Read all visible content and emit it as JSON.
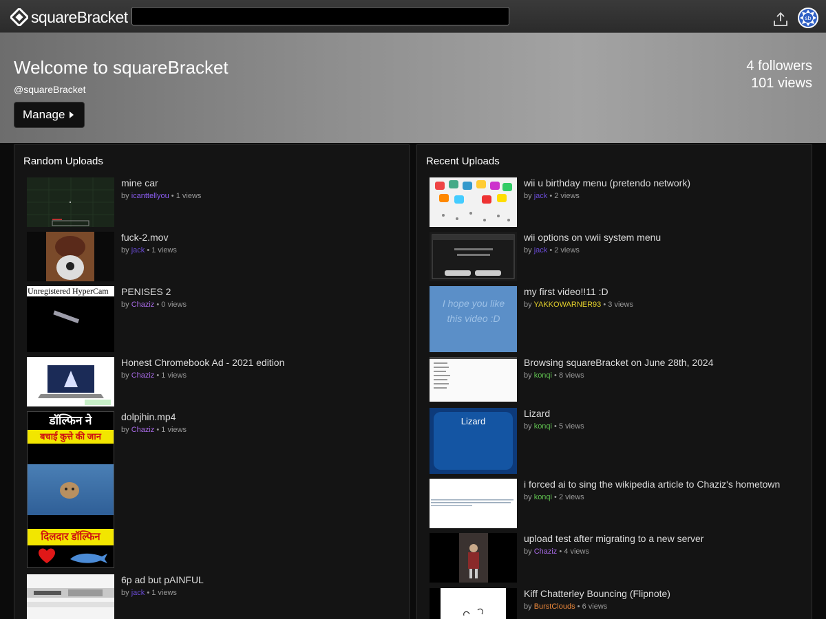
{
  "site": {
    "name": "squareBracket",
    "search_value": ""
  },
  "banner": {
    "title": "Welcome to squareBracket",
    "handle": "@squareBracket",
    "manage_label": "Manage",
    "followers": "4 followers",
    "views": "101 views"
  },
  "random": {
    "heading": "Random Uploads",
    "items": [
      {
        "title": "mine car",
        "by": "by",
        "author": "icanttellyou",
        "views": "• 1 views"
      },
      {
        "title": "fuck-2.mov",
        "by": "by",
        "author": "jack",
        "views": "• 1 views"
      },
      {
        "title": "PENISES 2",
        "by": "by",
        "author": "Chaziz",
        "views": "• 0 views",
        "thumb_text": "Unregistered HyperCam"
      },
      {
        "title": "Honest Chromebook Ad - 2021 edition",
        "by": "by",
        "author": "Chaziz",
        "views": "• 1 views"
      },
      {
        "title": "dolpjhin.mp4",
        "by": "by",
        "author": "Chaziz",
        "views": "• 1 views",
        "thumb_top_1": "डॉल्फिन ने",
        "thumb_top_2": "बचाई कुत्ते की जान",
        "thumb_bottom": "दिलदार डॉल्फिन"
      },
      {
        "title": "6p ad but pAINFUL",
        "by": "by",
        "author": "jack",
        "views": "• 1 views"
      }
    ]
  },
  "recent": {
    "heading": "Recent Uploads",
    "items": [
      {
        "title": "wii u birthday menu (pretendo network)",
        "by": "by",
        "author": "jack",
        "views": "• 2 views"
      },
      {
        "title": "wii options on vwii system menu",
        "by": "by",
        "author": "jack",
        "views": "• 2 views"
      },
      {
        "title": "my first video!!11 :D",
        "by": "by",
        "author": "YAKKOWARNER93",
        "views": "• 3 views",
        "thumb_text": "I hope you like this video :D"
      },
      {
        "title": "Browsing squareBracket on June 28th, 2024",
        "by": "by",
        "author": "konqi",
        "views": "• 8 views"
      },
      {
        "title": "Lizard",
        "by": "by",
        "author": "konqi",
        "views": "• 5 views",
        "thumb_text": "Lizard"
      },
      {
        "title": "i forced ai to sing the wikipedia article to Chaziz's hometown",
        "by": "by",
        "author": "konqi",
        "views": "• 2 views"
      },
      {
        "title": "upload test after migrating to a new server",
        "by": "by",
        "author": "Chaziz",
        "views": "• 4 views"
      },
      {
        "title": "Kiff Chatterley Bouncing (Flipnote)",
        "by": "by",
        "author": "BurstClouds",
        "views": "• 6 views"
      }
    ]
  },
  "colors": {
    "jack": "#6a4bd6",
    "icanttellyou": "#8a5cf0",
    "Chaziz": "#a86ae6",
    "YAKKOWARNER93": "#e6d22c",
    "konqi": "#5fc04f",
    "BurstClouds": "#f08a3c"
  },
  "icons": {
    "logo": "diamond-logo-icon",
    "upload": "upload-icon",
    "avatar": "avatar"
  }
}
